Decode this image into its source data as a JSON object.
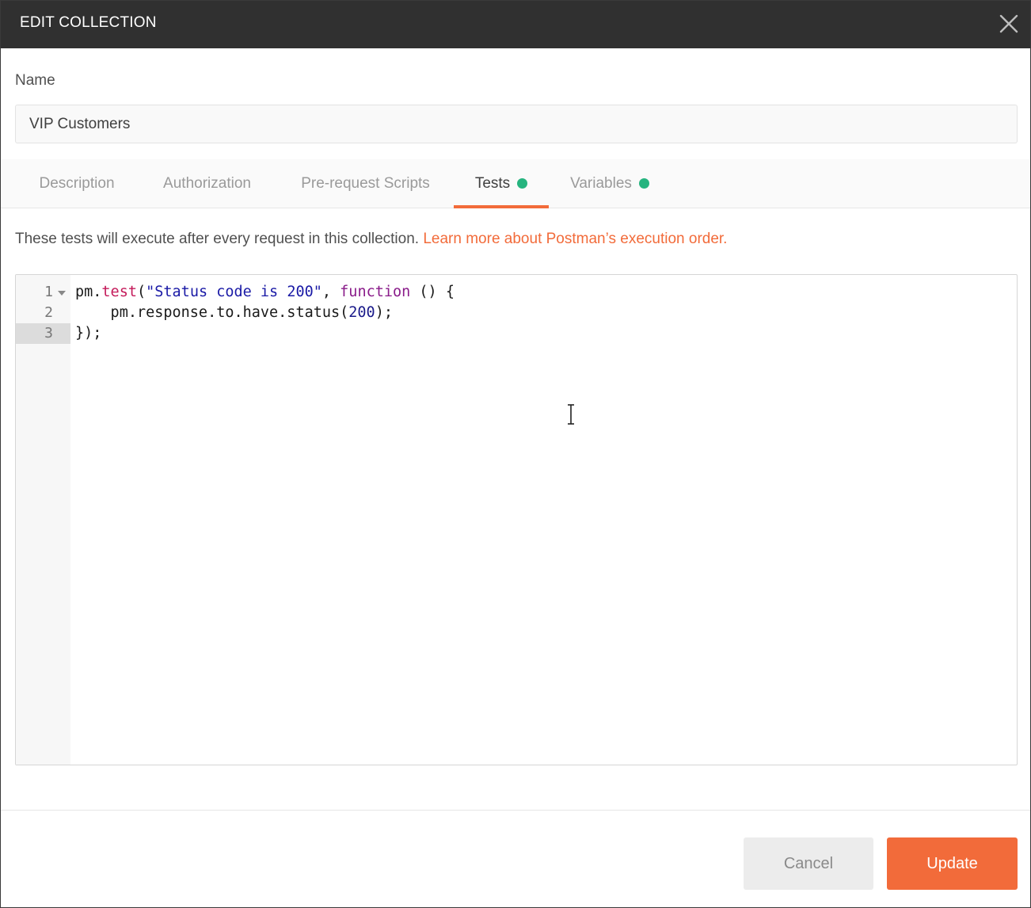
{
  "header": {
    "title": "EDIT COLLECTION",
    "close_icon": "close-icon"
  },
  "name_field": {
    "label": "Name",
    "value": "VIP Customers"
  },
  "tabs": [
    {
      "label": "Description",
      "active": false,
      "has_dot": false
    },
    {
      "label": "Authorization",
      "active": false,
      "has_dot": false
    },
    {
      "label": "Pre-request Scripts",
      "active": false,
      "has_dot": false
    },
    {
      "label": "Tests",
      "active": true,
      "has_dot": true
    },
    {
      "label": "Variables",
      "active": false,
      "has_dot": true
    }
  ],
  "info": {
    "text": "These tests will execute after every request in this collection. ",
    "link": "Learn more about Postman’s execution order."
  },
  "editor": {
    "line_numbers": [
      "1",
      "2",
      "3"
    ],
    "current_line": 3,
    "lines": [
      [
        {
          "t": "pm.",
          "c": ""
        },
        {
          "t": "test",
          "c": "prop"
        },
        {
          "t": "(",
          "c": ""
        },
        {
          "t": "\"Status code is 200\"",
          "c": "str"
        },
        {
          "t": ", ",
          "c": ""
        },
        {
          "t": "function",
          "c": "kw"
        },
        {
          "t": " () {",
          "c": ""
        }
      ],
      [
        {
          "t": "    pm.response.to.have.status(",
          "c": ""
        },
        {
          "t": "200",
          "c": "num"
        },
        {
          "t": ");",
          "c": ""
        }
      ],
      [
        {
          "t": "});",
          "c": ""
        }
      ]
    ]
  },
  "footer": {
    "cancel_label": "Cancel",
    "update_label": "Update"
  },
  "colors": {
    "header_bg": "#303030",
    "accent": "#f26b3a",
    "status_dot": "#26b47f",
    "cancel_bg": "#ececec"
  }
}
